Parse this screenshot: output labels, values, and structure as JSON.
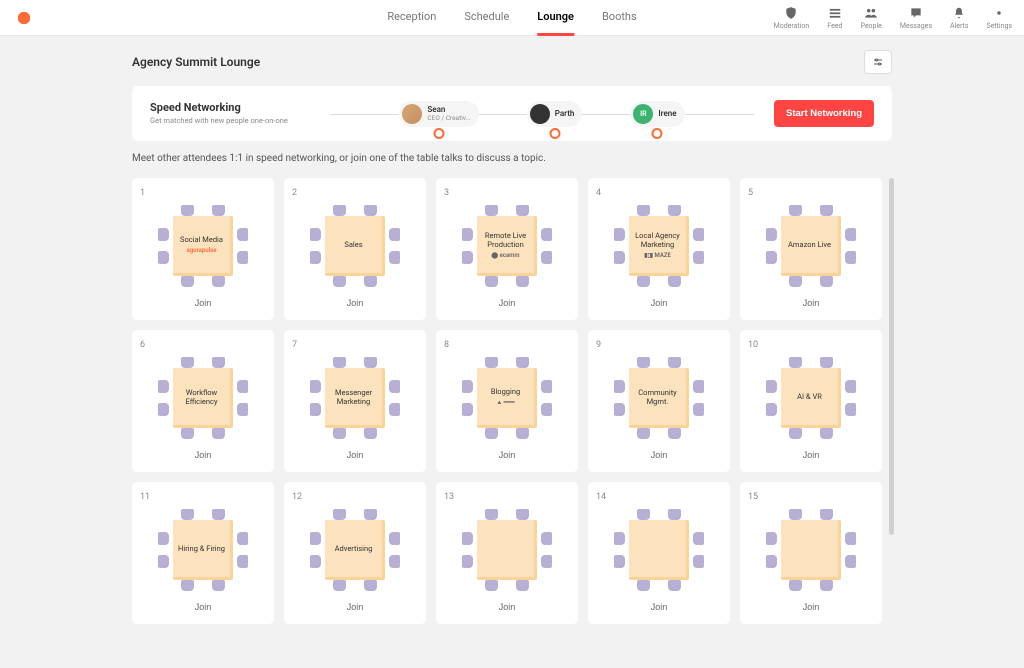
{
  "nav": {
    "items": [
      {
        "label": "Reception"
      },
      {
        "label": "Schedule"
      },
      {
        "label": "Lounge",
        "active": true
      },
      {
        "label": "Booths"
      }
    ],
    "right": [
      {
        "label": "Moderation",
        "icon": "shield-icon"
      },
      {
        "label": "Feed",
        "icon": "feed-icon"
      },
      {
        "label": "People",
        "icon": "people-icon"
      },
      {
        "label": "Messages",
        "icon": "messages-icon"
      },
      {
        "label": "Alerts",
        "icon": "bell-icon"
      },
      {
        "label": "Settings",
        "icon": "gear-icon"
      }
    ]
  },
  "page": {
    "title": "Agency Summit Lounge",
    "instruction": "Meet other attendees 1:1 in speed networking, or join one of the table talks to discuss a topic."
  },
  "speed": {
    "title": "Speed Networking",
    "subtitle": "Get matched with new people one-on-one",
    "button": "Start Networking",
    "people": [
      {
        "name": "Sean",
        "role": "CEO / Creativ...",
        "avatar": "img"
      },
      {
        "name": "Parth",
        "role": "",
        "avatar": "dark"
      },
      {
        "name": "Irene",
        "role": "",
        "avatar": "IR",
        "color": "green"
      }
    ]
  },
  "tables": [
    {
      "num": "1",
      "label": "Social Media",
      "sponsor": "agorapulse",
      "sponsorClass": "orange",
      "join": "Join"
    },
    {
      "num": "2",
      "label": "Sales",
      "sponsor": "",
      "join": "Join"
    },
    {
      "num": "3",
      "label": "Remote Live Production",
      "sponsor": "⬤ ecamm",
      "join": "Join"
    },
    {
      "num": "4",
      "label": "Local Agency Marketing",
      "sponsor": "▮◨ MAZE",
      "join": "Join"
    },
    {
      "num": "5",
      "label": "Amazon Live",
      "sponsor": "",
      "join": "Join"
    },
    {
      "num": "6",
      "label": "Workflow Efficiency",
      "sponsor": "",
      "join": "Join"
    },
    {
      "num": "7",
      "label": "Messenger Marketing",
      "sponsor": "",
      "join": "Join"
    },
    {
      "num": "8",
      "label": "Blogging",
      "sponsor": "▲ ━━━",
      "join": "Join"
    },
    {
      "num": "9",
      "label": "Community Mgmt.",
      "sponsor": "",
      "join": "Join"
    },
    {
      "num": "10",
      "label": "AI & VR",
      "sponsor": "",
      "join": "Join"
    },
    {
      "num": "11",
      "label": "Hiring & Firing",
      "sponsor": "",
      "join": "Join"
    },
    {
      "num": "12",
      "label": "Advertising",
      "sponsor": "",
      "join": "Join"
    },
    {
      "num": "13",
      "label": "",
      "sponsor": "",
      "join": "Join"
    },
    {
      "num": "14",
      "label": "",
      "sponsor": "",
      "join": "Join"
    },
    {
      "num": "15",
      "label": "",
      "sponsor": "",
      "join": "Join"
    }
  ]
}
